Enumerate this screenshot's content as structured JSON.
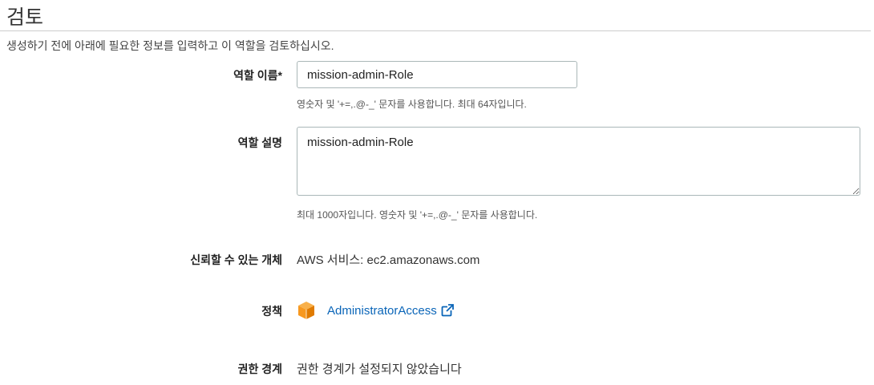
{
  "header": {
    "title": "검토",
    "description": "생성하기 전에 아래에 필요한 정보를 입력하고 이 역할을 검토하십시오."
  },
  "form": {
    "role_name": {
      "label": "역할 이름*",
      "value": "mission-admin-Role",
      "hint": "영숫자 및 '+=,.@-_' 문자를 사용합니다. 최대 64자입니다."
    },
    "role_description": {
      "label": "역할 설명",
      "value": "mission-admin-Role",
      "hint": "최대 1000자입니다. 영숫자 및 '+=,.@-_' 문자를 사용합니다."
    },
    "trusted_entity": {
      "label": "신뢰할 수 있는 개체",
      "value": "AWS 서비스: ec2.amazonaws.com"
    },
    "policy": {
      "label": "정책",
      "link_text": "AdministratorAccess",
      "icon": "aws-policy-cube-icon",
      "external_icon": "external-link-icon"
    },
    "permissions_boundary": {
      "label": "권한 경계",
      "value": "권한 경계가 설정되지 않았습니다"
    }
  },
  "colors": {
    "link": "#0a65b8",
    "policy_icon": "#f7981f",
    "input_border": "#aab7b8"
  }
}
